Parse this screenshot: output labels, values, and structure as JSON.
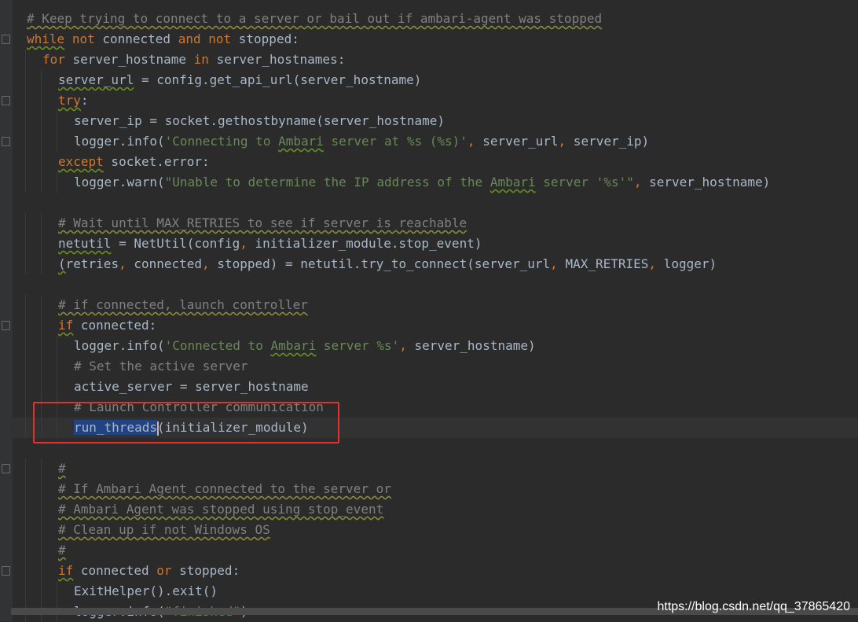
{
  "editor": {
    "lines": [
      {
        "indent": 0,
        "parts": [
          [
            "cm sq",
            "# Keep trying to connect to a server or bail out if ambari-agent was stopped"
          ]
        ]
      },
      {
        "indent": 0,
        "parts": [
          [
            "kw sq",
            "while"
          ],
          [
            "",
            " "
          ],
          [
            "kw",
            "not"
          ],
          [
            "",
            " connected "
          ],
          [
            "kw",
            "and"
          ],
          [
            "",
            " "
          ],
          [
            "kw",
            "not"
          ],
          [
            "",
            " stopped:"
          ]
        ]
      },
      {
        "indent": 1,
        "parts": [
          [
            "kw",
            "for"
          ],
          [
            "",
            " server_hostname "
          ],
          [
            "kw",
            "in"
          ],
          [
            "",
            " server_hostnames:"
          ]
        ]
      },
      {
        "indent": 2,
        "parts": [
          [
            "sq",
            "server_url"
          ],
          [
            "",
            " = config.get_api_url(server_hostname)"
          ]
        ]
      },
      {
        "indent": 2,
        "parts": [
          [
            "kw sq",
            "try"
          ],
          [
            "",
            ":"
          ]
        ]
      },
      {
        "indent": 3,
        "parts": [
          [
            "",
            "server_ip = socket.gethostbyname(server_hostname)"
          ]
        ]
      },
      {
        "indent": 3,
        "parts": [
          [
            "",
            "logger.info("
          ],
          [
            "str",
            "'Connecting to "
          ],
          [
            "str sq",
            "Ambari"
          ],
          [
            "str",
            " server at %s (%s)'"
          ],
          [
            "kw",
            ","
          ],
          [
            "",
            " server_url"
          ],
          [
            "kw",
            ","
          ],
          [
            "",
            " server_ip)"
          ]
        ]
      },
      {
        "indent": 2,
        "parts": [
          [
            "kw sq",
            "except"
          ],
          [
            "",
            " socket.error:"
          ]
        ]
      },
      {
        "indent": 3,
        "parts": [
          [
            "",
            "logger.warn("
          ],
          [
            "str",
            "\"Unable to determine the IP address of the "
          ],
          [
            "str sq",
            "Ambari"
          ],
          [
            "str",
            " server '%s'\""
          ],
          [
            "kw",
            ","
          ],
          [
            "",
            " server_hostname)"
          ]
        ]
      },
      {
        "indent": 0,
        "parts": []
      },
      {
        "indent": 2,
        "parts": [
          [
            "cm sq",
            "# Wait until MAX_RETRIES to see if server is reachable"
          ]
        ]
      },
      {
        "indent": 2,
        "parts": [
          [
            "sq",
            "netutil"
          ],
          [
            "",
            " = NetUtil(config"
          ],
          [
            "kw",
            ","
          ],
          [
            "",
            " initializer_module.stop_event)"
          ]
        ]
      },
      {
        "indent": 2,
        "parts": [
          [
            "sq",
            "("
          ],
          [
            "",
            "retries"
          ],
          [
            "kw",
            ","
          ],
          [
            "",
            " connected"
          ],
          [
            "kw",
            ","
          ],
          [
            "",
            " stopped) = netutil.try_to_connect(server_url"
          ],
          [
            "kw",
            ","
          ],
          [
            "",
            " MAX_RETRIES"
          ],
          [
            "kw",
            ","
          ],
          [
            "",
            " logger)"
          ]
        ]
      },
      {
        "indent": 0,
        "parts": []
      },
      {
        "indent": 2,
        "parts": [
          [
            "cm sq",
            "# if connected, launch controller"
          ]
        ]
      },
      {
        "indent": 2,
        "parts": [
          [
            "kw sq",
            "if"
          ],
          [
            "",
            " connected:"
          ]
        ]
      },
      {
        "indent": 3,
        "parts": [
          [
            "",
            "logger.info("
          ],
          [
            "str",
            "'Connected to "
          ],
          [
            "str sq",
            "Ambari"
          ],
          [
            "str",
            " server %s'"
          ],
          [
            "kw",
            ","
          ],
          [
            "",
            " server_hostname)"
          ]
        ]
      },
      {
        "indent": 3,
        "parts": [
          [
            "cm",
            "# Set the active server"
          ]
        ]
      },
      {
        "indent": 3,
        "parts": [
          [
            "",
            "active_server = server_hostname"
          ]
        ]
      },
      {
        "indent": 3,
        "parts": [
          [
            "cm",
            "# Launch Controller communication"
          ]
        ]
      },
      {
        "indent": 3,
        "current": true,
        "parts": [
          [
            "sel",
            "run_threads"
          ],
          [
            "caret",
            ""
          ],
          [
            "",
            "(initializer_module)"
          ]
        ]
      },
      {
        "indent": 0,
        "parts": []
      },
      {
        "indent": 2,
        "parts": [
          [
            "cm sq",
            "#"
          ]
        ]
      },
      {
        "indent": 2,
        "parts": [
          [
            "cm sq",
            "# If Ambari Agent connected to the server or"
          ]
        ]
      },
      {
        "indent": 2,
        "parts": [
          [
            "cm sq",
            "# Ambari Agent was stopped using stop_event"
          ]
        ]
      },
      {
        "indent": 2,
        "parts": [
          [
            "cm sq",
            "# Clean up if not Windows OS"
          ]
        ]
      },
      {
        "indent": 2,
        "parts": [
          [
            "cm sq",
            "#"
          ]
        ]
      },
      {
        "indent": 2,
        "parts": [
          [
            "kw sq",
            "if"
          ],
          [
            "",
            " connected "
          ],
          [
            "kw",
            "or"
          ],
          [
            "",
            " stopped:"
          ]
        ]
      },
      {
        "indent": 3,
        "parts": [
          [
            "",
            "ExitHelper().exit()"
          ]
        ]
      },
      {
        "indent": 3,
        "parts": [
          [
            "",
            "logger.info("
          ],
          [
            "str",
            "\"finished\""
          ],
          [
            "",
            ")"
          ]
        ]
      }
    ]
  },
  "gutter": {
    "intention_bulb_icon": "lightbulb-icon"
  },
  "watermark": "https://blog.csdn.net/qq_37865420"
}
